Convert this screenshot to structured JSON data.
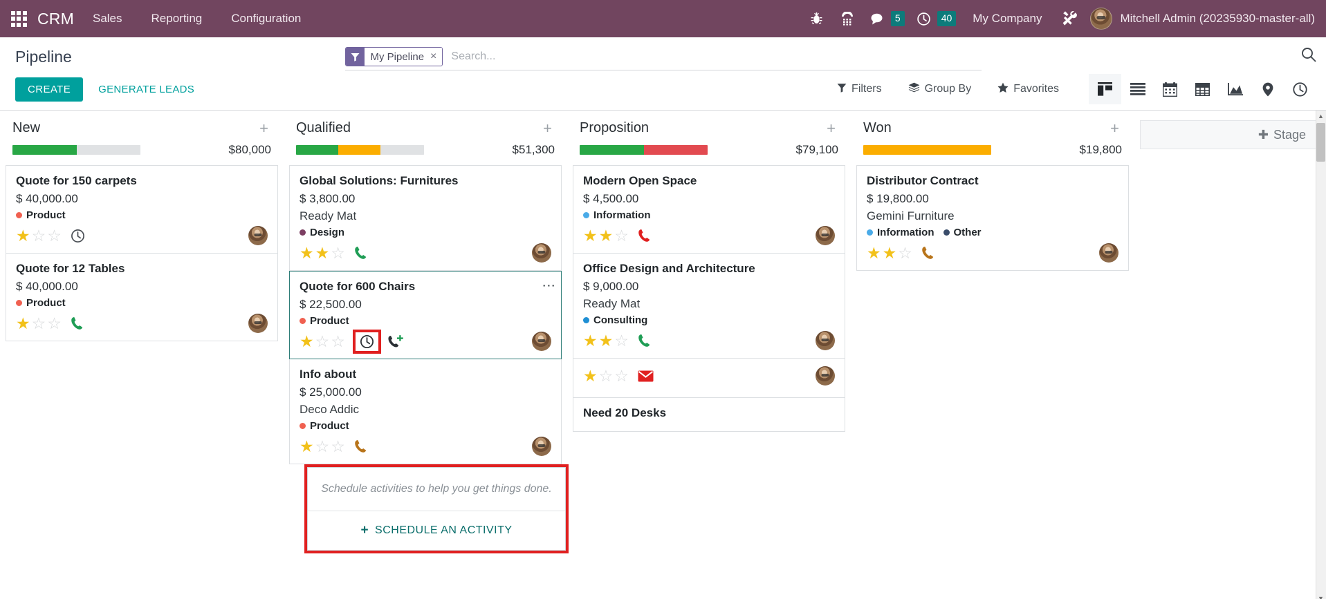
{
  "navbar": {
    "apps_icon": "apps-grid-icon",
    "brand": "CRM",
    "menus": [
      {
        "label": "Sales"
      },
      {
        "label": "Reporting"
      },
      {
        "label": "Configuration"
      }
    ],
    "sys_icons": [
      {
        "name": "bug-icon"
      },
      {
        "name": "dialpad-phone-icon"
      }
    ],
    "messages": {
      "icon": "chat-bubble-icon",
      "count": "5"
    },
    "activities": {
      "icon": "clock-icon",
      "count": "40"
    },
    "company": "My Company",
    "tools_icon": "tools-icon",
    "user": "Mitchell Admin (20235930-master-all)",
    "avatar": "user-avatar"
  },
  "control_panel": {
    "title": "Pipeline",
    "search": {
      "facet_icon": "filter-funnel-icon",
      "facet_label": "My Pipeline",
      "facet_close": "×",
      "placeholder": "Search...",
      "value": "",
      "search_icon": "search-icon"
    },
    "buttons": {
      "create": "CREATE",
      "generate_leads": "GENERATE LEADS"
    },
    "dropdowns": [
      {
        "label": "Filters",
        "icon": "filter-icon"
      },
      {
        "label": "Group By",
        "icon": "layers-icon"
      },
      {
        "label": "Favorites",
        "icon": "star-icon"
      }
    ],
    "views": [
      {
        "name": "kanban-view",
        "active": true
      },
      {
        "name": "list-view",
        "active": false
      },
      {
        "name": "calendar-view",
        "active": false
      },
      {
        "name": "pivot-view",
        "active": false
      },
      {
        "name": "graph-view",
        "active": false
      },
      {
        "name": "map-view",
        "active": false
      },
      {
        "name": "activity-view",
        "active": false
      }
    ]
  },
  "kanban": {
    "add_stage_label": "Stage",
    "columns": [
      {
        "title": "New",
        "amount": "$80,000",
        "segments": [
          {
            "color": "#28a745",
            "pct": 50
          },
          {
            "color": "#e0e2e4",
            "pct": 50
          }
        ],
        "cards": [
          {
            "title": "Quote for 150 carpets",
            "amount": "$ 40,000.00",
            "partner": "",
            "tags": [
              {
                "label": "Product",
                "color": "#f06050"
              }
            ],
            "stars": 1,
            "activity_icon": "clock-icon",
            "activity_color": "#4a4f55",
            "selected": false
          },
          {
            "title": "Quote for 12 Tables",
            "amount": "$ 40,000.00",
            "partner": "",
            "tags": [
              {
                "label": "Product",
                "color": "#f06050"
              }
            ],
            "stars": 1,
            "activity_icon": "phone-icon",
            "activity_color": "#1f9d55",
            "selected": false
          }
        ]
      },
      {
        "title": "Qualified",
        "amount": "$51,300",
        "segments": [
          {
            "color": "#28a745",
            "pct": 33
          },
          {
            "color": "#fbad00",
            "pct": 33
          },
          {
            "color": "#e0e2e4",
            "pct": 34
          }
        ],
        "cards": [
          {
            "title": "Global Solutions: Furnitures",
            "amount": "$ 3,800.00",
            "partner": "Ready Mat",
            "tags": [
              {
                "label": "Design",
                "color": "#7c3f62"
              }
            ],
            "stars": 2,
            "activity_icon": "phone-icon",
            "activity_color": "#1f9d55",
            "selected": false
          },
          {
            "title": "Quote for 600 Chairs",
            "amount": "$ 22,500.00",
            "partner": "",
            "tags": [
              {
                "label": "Product",
                "color": "#f06050"
              }
            ],
            "stars": 1,
            "activity_icon": "clock-icon",
            "activity_color": "#2b3035",
            "activity_highlighted": true,
            "extra_icon": "phone-plus-icon",
            "kebab": "kebab-menu-icon",
            "selected": true
          },
          {
            "title": "Info about",
            "amount": "$ 25,000.00",
            "partner": "Deco Addic",
            "tags": [
              {
                "label": "Product",
                "color": "#f06050"
              }
            ],
            "stars": 1,
            "activity_icon": "phone-icon",
            "activity_color": "#b8741a",
            "selected": false
          }
        ]
      },
      {
        "title": "Proposition",
        "amount": "$79,100",
        "segments": [
          {
            "color": "#28a745",
            "pct": 50
          },
          {
            "color": "#e24a50",
            "pct": 50
          }
        ],
        "cards": [
          {
            "title": "Modern Open Space",
            "amount": "$ 4,500.00",
            "partner": "",
            "tags": [
              {
                "label": "Information",
                "color": "#4aabe8"
              }
            ],
            "stars": 2,
            "activity_icon": "phone-icon",
            "activity_color": "#e02020",
            "selected": false
          },
          {
            "title": "Office Design and Architecture",
            "amount": "$ 9,000.00",
            "partner": "Ready Mat",
            "tags": [
              {
                "label": "Consulting",
                "color": "#1f8fd4"
              }
            ],
            "stars": 2,
            "activity_icon": "phone-icon",
            "activity_color": "#1f9d55",
            "selected": false
          },
          {
            "title": "Need 20 Desks",
            "amount": "",
            "partner": "",
            "tags": [],
            "stars": 1,
            "activity_icon": "envelope-icon",
            "activity_color": "#e02020",
            "selected": false,
            "truncated": true
          }
        ]
      },
      {
        "title": "Won",
        "amount": "$19,800",
        "segments": [
          {
            "color": "#fbad00",
            "pct": 100
          }
        ],
        "cards": [
          {
            "title": "Distributor Contract",
            "amount": "$ 19,800.00",
            "partner": "Gemini Furniture",
            "tags": [
              {
                "label": "Information",
                "color": "#4aabe8"
              },
              {
                "label": "Other",
                "color": "#3b4d6b"
              }
            ],
            "stars": 2,
            "activity_icon": "phone-icon",
            "activity_color": "#b8741a",
            "selected": false
          }
        ]
      }
    ]
  },
  "activity_popover": {
    "empty_text": "Schedule activities to help you get things done.",
    "action_label": "SCHEDULE AN ACTIVITY",
    "plus": "+"
  },
  "colors": {
    "navbar": "#71455f",
    "accent": "#00a09d",
    "highlight": "#e02020",
    "selected_border": "#2e7d78"
  }
}
